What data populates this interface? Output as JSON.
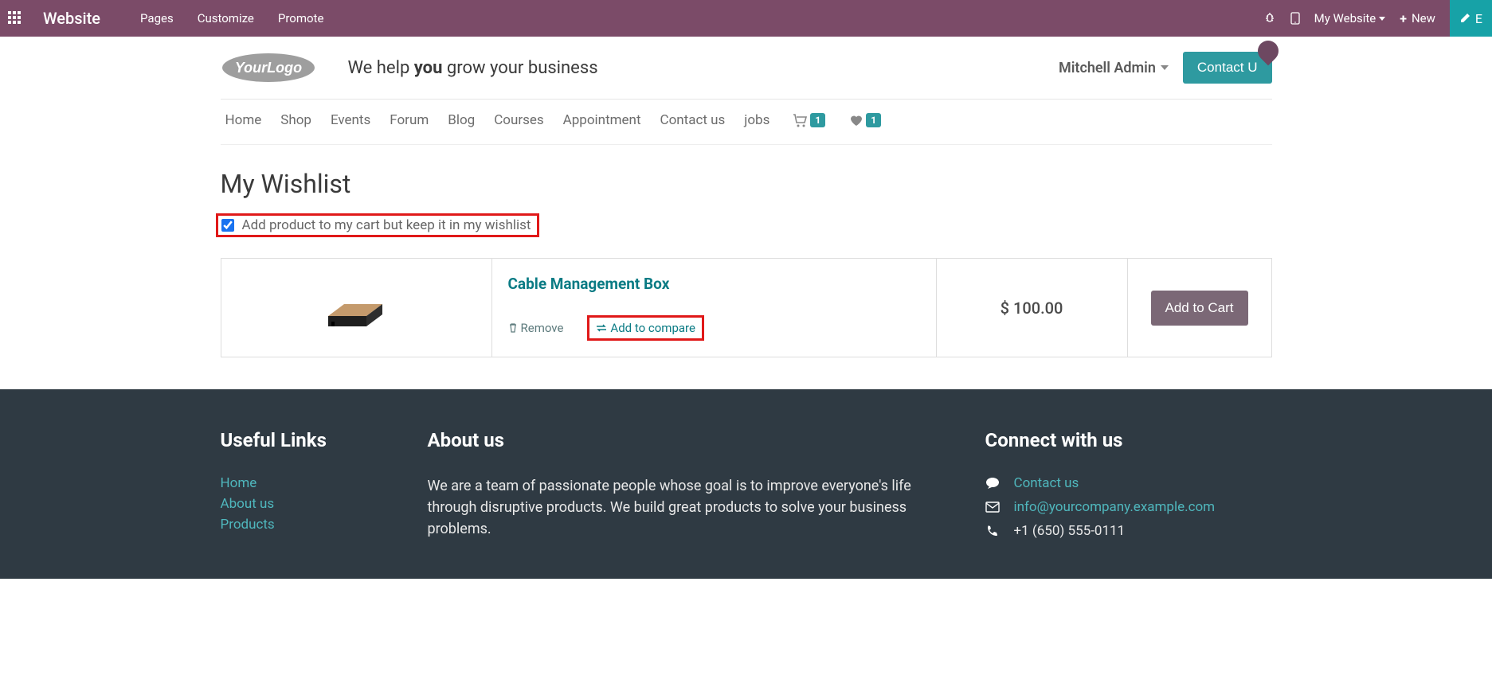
{
  "topbar": {
    "title": "Website",
    "menu": [
      "Pages",
      "Customize",
      "Promote"
    ],
    "my_website": "My Website",
    "new_label": "New",
    "edit_label": "E"
  },
  "header": {
    "tagline_prefix": "We help ",
    "tagline_bold": "you",
    "tagline_suffix": " grow your business",
    "user_name": "Mitchell Admin",
    "contact_btn": "Contact U"
  },
  "nav": {
    "items": [
      "Home",
      "Shop",
      "Events",
      "Forum",
      "Blog",
      "Courses",
      "Appointment",
      "Contact us",
      "jobs"
    ],
    "cart_count": "1",
    "wish_count": "1"
  },
  "page": {
    "title": "My Wishlist",
    "keep_label": "Add product to my cart but keep it in my wishlist"
  },
  "wishlist": {
    "product_name": "Cable Management Box",
    "remove_label": "Remove",
    "compare_label": "Add to compare",
    "price": "$ 100.00",
    "add_cart": "Add to Cart"
  },
  "footer": {
    "useful_title": "Useful Links",
    "links": [
      "Home",
      "About us",
      "Products"
    ],
    "about_title": "About us",
    "about_text": "We are a team of passionate people whose goal is to improve everyone's life through disruptive products. We build great products to solve your business problems.",
    "connect_title": "Connect with us",
    "contact_link": "Contact us",
    "email": "info@yourcompany.example.com",
    "phone": "+1 (650) 555-0111"
  }
}
